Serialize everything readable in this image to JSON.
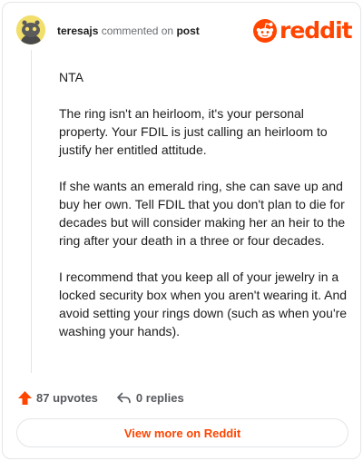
{
  "header": {
    "username": "teresajs",
    "action_text": "commented on",
    "post_link": "post",
    "brand": "reddit"
  },
  "comment": {
    "paragraphs": [
      "NTA",
      "The ring isn't an heirloom, it's your personal property. Your FDIL is just calling an heirloom to justify her entitled attitude.",
      "If she wants an emerald ring, she can save up and buy her own. Tell FDIL that you don't plan to die for decades but will consider making her an heir to the ring after your death in a three or four decades.",
      "I recommend that you keep all of your jewelry in a locked security box when you aren't wearing it. And avoid setting your rings down (such as when you're washing your hands)."
    ]
  },
  "footer": {
    "upvotes": "87 upvotes",
    "replies": "0 replies",
    "view_more": "View more on Reddit"
  },
  "colors": {
    "brand": "#ff4500",
    "avatar_bg": "#f2de6a"
  },
  "icons": {
    "upvote": "upvote-arrow-icon",
    "reply": "reply-arrow-icon",
    "brand": "reddit-snoo-icon"
  }
}
